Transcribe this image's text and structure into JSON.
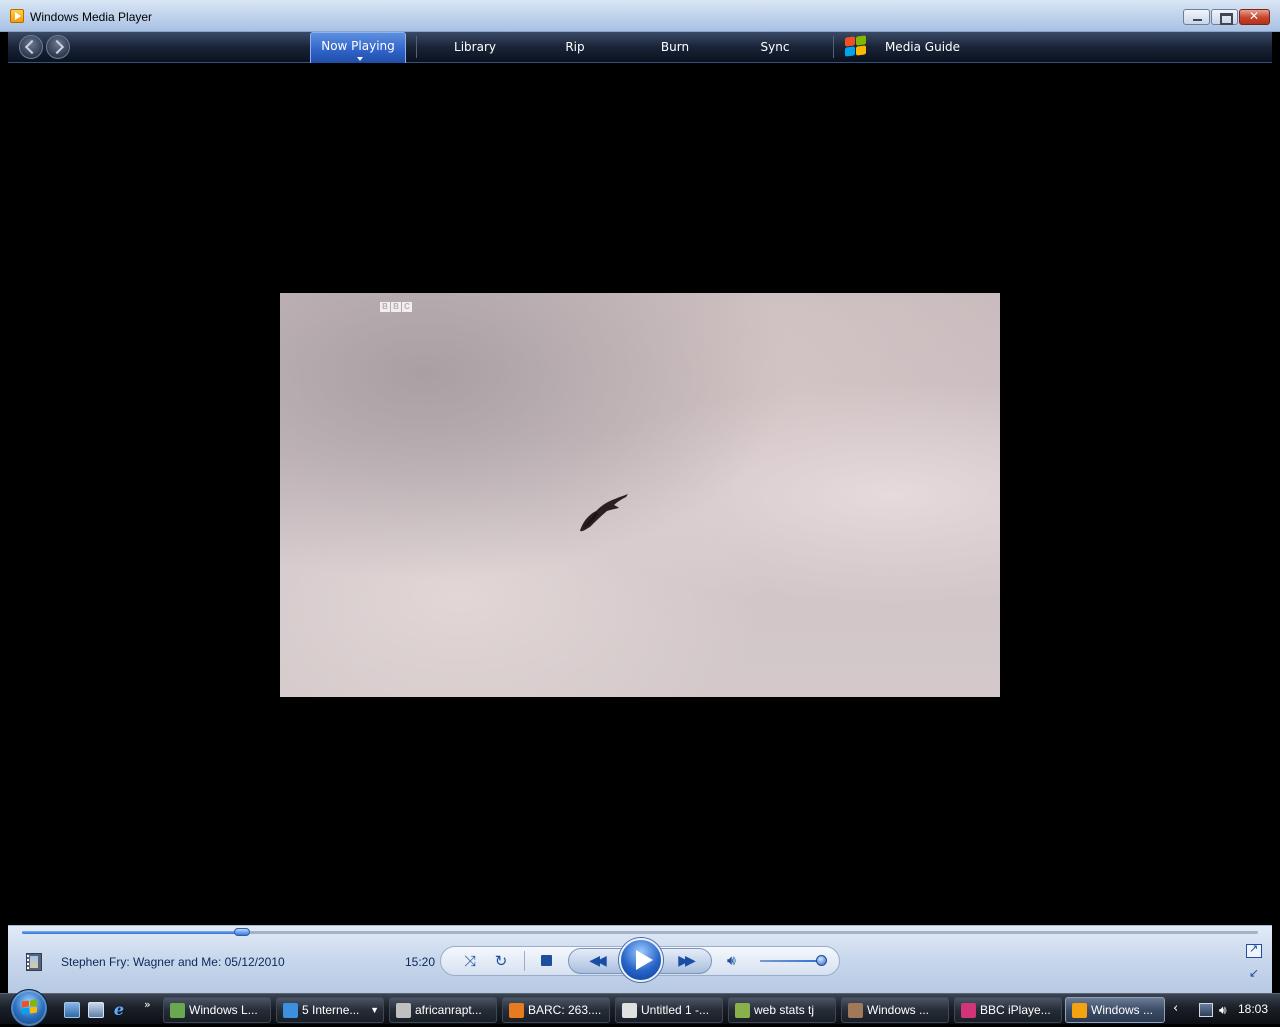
{
  "window": {
    "title": "Windows Media Player"
  },
  "nav": {
    "tabs": [
      {
        "label": "Now Playing",
        "active": true
      },
      {
        "label": "Library"
      },
      {
        "label": "Rip"
      },
      {
        "label": "Burn"
      },
      {
        "label": "Sync"
      },
      {
        "label": "Media Guide"
      }
    ]
  },
  "video": {
    "broadcaster_logo": [
      "B",
      "B",
      "C"
    ]
  },
  "player": {
    "now_playing": "Stephen Fry: Wagner and Me: 05/12/2010",
    "elapsed": "15:20",
    "seek_fraction": 0.178,
    "volume_fraction": 0.95,
    "icons": {
      "shuffle": "shuffle-icon",
      "repeat": "repeat-icon",
      "stop": "stop-icon",
      "previous": "previous-icon",
      "play": "play-icon",
      "next": "next-icon",
      "volume": "speaker-icon"
    }
  },
  "taskbar": {
    "buttons": [
      {
        "label": "Windows L...",
        "icon_color": "#6aa84f"
      },
      {
        "label": "5 Interne...",
        "icon_color": "#3d8fe0",
        "group": true
      },
      {
        "label": "africanrapt...",
        "icon_color": "#c0c0c0"
      },
      {
        "label": "BARC: 263....",
        "icon_color": "#e87a20"
      },
      {
        "label": "Untitled 1 -...",
        "icon_color": "#e0e0e0"
      },
      {
        "label": "web stats tj",
        "icon_color": "#88b04b"
      },
      {
        "label": "Windows ...",
        "icon_color": "#a0785a"
      },
      {
        "label": "BBC iPlaye...",
        "icon_color": "#d0357a"
      },
      {
        "label": "Windows ...",
        "icon_color": "#f2a30f",
        "active": true
      }
    ],
    "clock": "18:03"
  },
  "colors": {
    "accent": "#2f62c6",
    "nav_bg": "#1a2438",
    "controls_bg": "#c8d7ec"
  }
}
